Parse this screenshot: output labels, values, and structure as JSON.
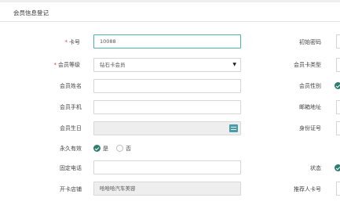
{
  "header": {
    "title": "会员信息登记"
  },
  "form": {
    "card_no": {
      "label": "卡号",
      "value": "10088"
    },
    "level": {
      "label": "会员等级",
      "value": "钻石卡会员"
    },
    "name": {
      "label": "会员姓名",
      "value": ""
    },
    "phone": {
      "label": "会员手机",
      "value": ""
    },
    "birthday": {
      "label": "会员生日",
      "value": ""
    },
    "permanent": {
      "label": "永久有效",
      "options": [
        "是",
        "否"
      ],
      "selected": "是"
    },
    "landline": {
      "label": "固定电话",
      "value": ""
    },
    "store": {
      "label": "开卡店铺",
      "value": "哈哈哈汽车美容"
    }
  },
  "right_labels": {
    "initial_password": "初始密码",
    "card_type": "会员卡类型",
    "gender": "会员性别",
    "email": "邮箱地址",
    "id_number": "身份证号",
    "status": "状态",
    "referrer_card": "推荐人卡号"
  },
  "colors": {
    "accent": "#2e7d6e",
    "required": "#e53935",
    "focus_border": "#4fb0a8"
  }
}
